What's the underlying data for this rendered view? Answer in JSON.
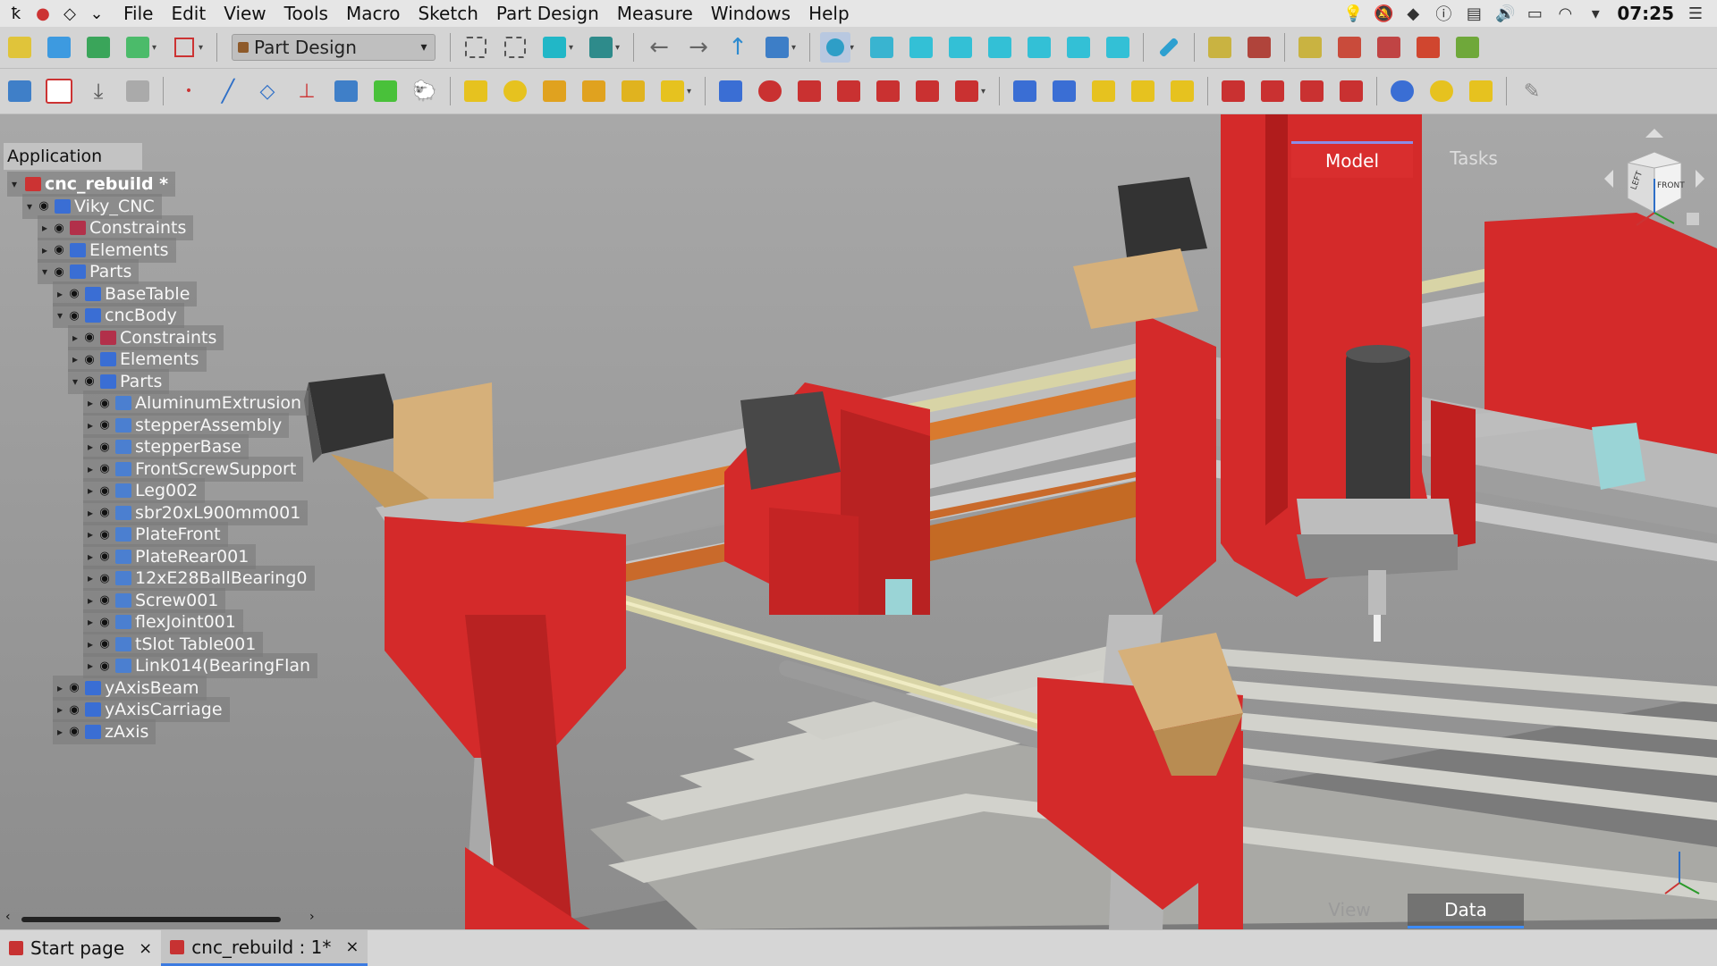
{
  "menubar": {
    "items": [
      "File",
      "Edit",
      "View",
      "Tools",
      "Macro",
      "Sketch",
      "Part Design",
      "Measure",
      "Windows",
      "Help"
    ],
    "clock": "07:25"
  },
  "toolbar": {
    "workbench": "Part Design"
  },
  "tree": {
    "header": "Application",
    "rows": [
      {
        "label": "cnc_rebuild *",
        "depth": 0,
        "expanded": true,
        "root": true,
        "icon": "document-icon"
      },
      {
        "label": "Viky_CNC",
        "depth": 1,
        "expanded": true,
        "icon": "assembly-icon"
      },
      {
        "label": "Constraints",
        "depth": 2,
        "expanded": false,
        "icon": "constraints-icon"
      },
      {
        "label": "Elements",
        "depth": 2,
        "expanded": false,
        "icon": "elements-icon"
      },
      {
        "label": "Parts",
        "depth": 2,
        "expanded": true,
        "icon": "parts-icon"
      },
      {
        "label": "BaseTable",
        "depth": 3,
        "expanded": false,
        "icon": "assembly-icon"
      },
      {
        "label": "cncBody",
        "depth": 3,
        "expanded": true,
        "icon": "assembly-icon"
      },
      {
        "label": "Constraints",
        "depth": 4,
        "expanded": false,
        "icon": "constraints-icon"
      },
      {
        "label": "Elements",
        "depth": 4,
        "expanded": false,
        "icon": "elements-icon"
      },
      {
        "label": "Parts",
        "depth": 4,
        "expanded": true,
        "icon": "parts-icon"
      },
      {
        "label": "AluminumExtrusion",
        "depth": 5,
        "expanded": false,
        "icon": "link-icon"
      },
      {
        "label": "stepperAssembly",
        "depth": 5,
        "expanded": false,
        "icon": "link-icon"
      },
      {
        "label": "stepperBase",
        "depth": 5,
        "expanded": false,
        "icon": "link-icon"
      },
      {
        "label": "FrontScrewSupport",
        "depth": 5,
        "expanded": false,
        "icon": "link-icon"
      },
      {
        "label": "Leg002",
        "depth": 5,
        "expanded": false,
        "icon": "link-icon"
      },
      {
        "label": "sbr20xL900mm001",
        "depth": 5,
        "expanded": false,
        "icon": "link-icon"
      },
      {
        "label": "PlateFront",
        "depth": 5,
        "expanded": false,
        "icon": "link-icon"
      },
      {
        "label": "PlateRear001",
        "depth": 5,
        "expanded": false,
        "icon": "link-icon"
      },
      {
        "label": "12xE28BallBearing0",
        "depth": 5,
        "expanded": false,
        "icon": "link-icon"
      },
      {
        "label": "Screw001",
        "depth": 5,
        "expanded": false,
        "icon": "link-icon"
      },
      {
        "label": "flexJoint001",
        "depth": 5,
        "expanded": false,
        "icon": "link-icon"
      },
      {
        "label": "tSlot Table001",
        "depth": 5,
        "expanded": false,
        "icon": "link-icon"
      },
      {
        "label": "Link014(BearingFlan",
        "depth": 5,
        "expanded": false,
        "icon": "link-icon"
      },
      {
        "label": "yAxisBeam",
        "depth": 3,
        "expanded": false,
        "icon": "assembly-icon"
      },
      {
        "label": "yAxisCarriage",
        "depth": 3,
        "expanded": false,
        "icon": "assembly-icon"
      },
      {
        "label": "zAxis",
        "depth": 3,
        "expanded": false,
        "icon": "assembly-icon"
      }
    ]
  },
  "combo_tabs": {
    "model": "Model",
    "tasks": "Tasks"
  },
  "prop_tabs": {
    "view": "View",
    "data": "Data"
  },
  "navcube": {
    "left": "LEFT",
    "front": "FRONT"
  },
  "doc_tabs": [
    {
      "label": "Start page",
      "active": false
    },
    {
      "label": "cnc_rebuild : 1*",
      "active": true
    }
  ],
  "colors": {
    "accent_red": "#d42a2a",
    "beam_grey": "#b9b9b9",
    "rod_cream": "#d8d4a6",
    "bracket_tan": "#d6b07a",
    "tree_bg": "#7a7a7a"
  }
}
